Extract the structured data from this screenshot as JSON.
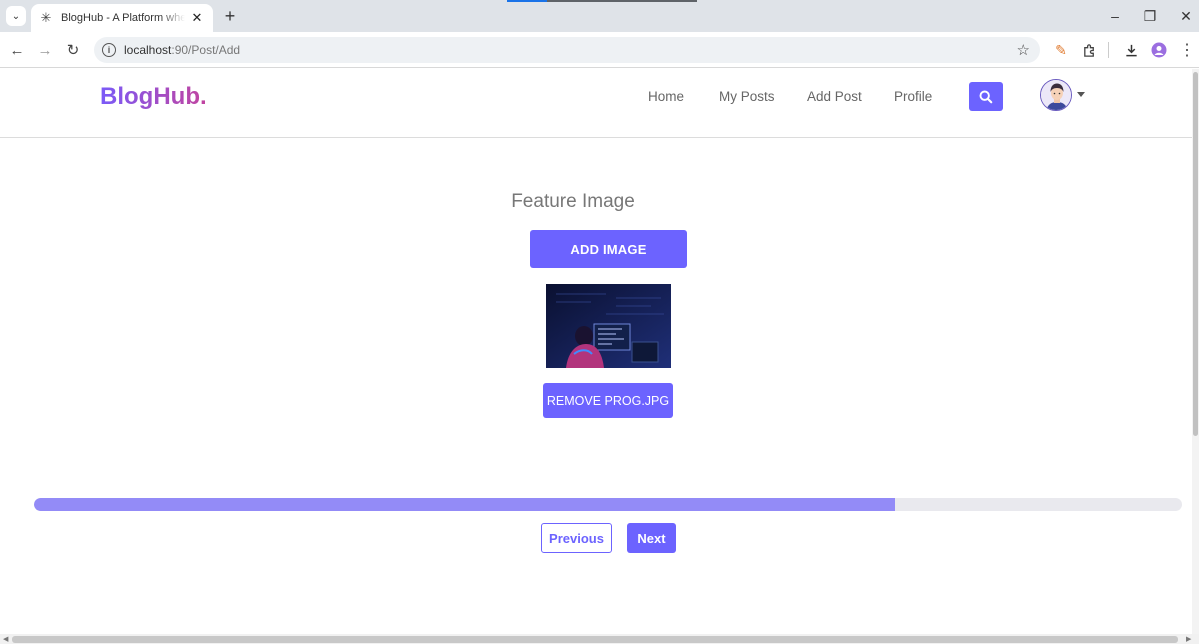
{
  "browser": {
    "tab_title": "BlogHub - A Platform where you",
    "url_host": "localhost",
    "url_path": ":90/Post/Add",
    "new_tab": "+",
    "close": "✕"
  },
  "site": {
    "logo": "BlogHub.",
    "nav": [
      "Home",
      "My Posts",
      "Add Post",
      "Profile"
    ]
  },
  "form": {
    "section_title": "Feature Image",
    "add_image_label": "ADD IMAGE",
    "remove_label": "REMOVE PROG.JPG",
    "progress_percent": 75,
    "previous_label": "Previous",
    "next_label": "Next"
  },
  "colors": {
    "accent": "#6c63ff",
    "progress": "#938bf7"
  },
  "icons": {
    "search": "search-icon",
    "avatar": "avatar-icon"
  }
}
